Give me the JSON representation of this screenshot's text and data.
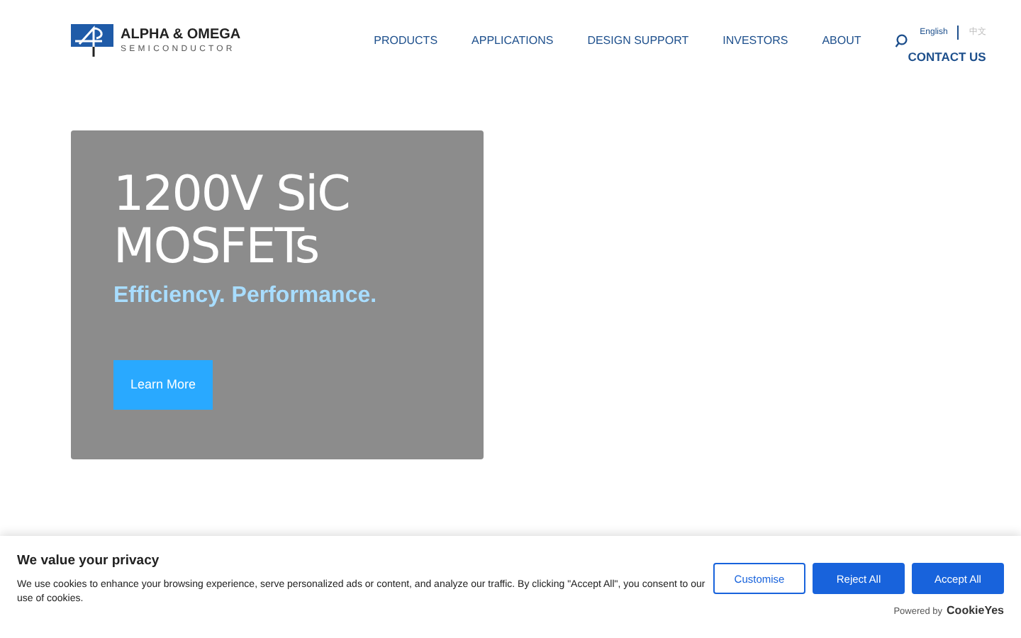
{
  "header": {
    "logo": {
      "name": "ALPHA & OMEGA",
      "tagline": "SEMICONDUCTOR"
    },
    "nav": [
      {
        "label": "PRODUCTS"
      },
      {
        "label": "APPLICATIONS"
      },
      {
        "label": "DESIGN SUPPORT"
      },
      {
        "label": "INVESTORS"
      },
      {
        "label": "ABOUT"
      }
    ],
    "languages": [
      {
        "label": "English",
        "selected": true
      },
      {
        "label": "中文",
        "selected": false
      }
    ],
    "contact": "CONTACT US"
  },
  "hero": {
    "title": "1200V SiC MOSFETs",
    "subtitle": "Efficiency. Performance.",
    "button": "Learn More"
  },
  "cookie_banner": {
    "title": "We value your privacy",
    "text": "We use cookies to enhance your browsing experience, serve personalized ads or content, and analyze our traffic. By clicking \"Accept All\", you consent to our use of cookies.",
    "buttons": [
      {
        "label": "Customise",
        "kind": "outline"
      },
      {
        "label": "Reject All",
        "kind": "solid"
      },
      {
        "label": "Accept All",
        "kind": "solid"
      }
    ],
    "powered_by": "Powered by",
    "brand": "CookieYes"
  }
}
